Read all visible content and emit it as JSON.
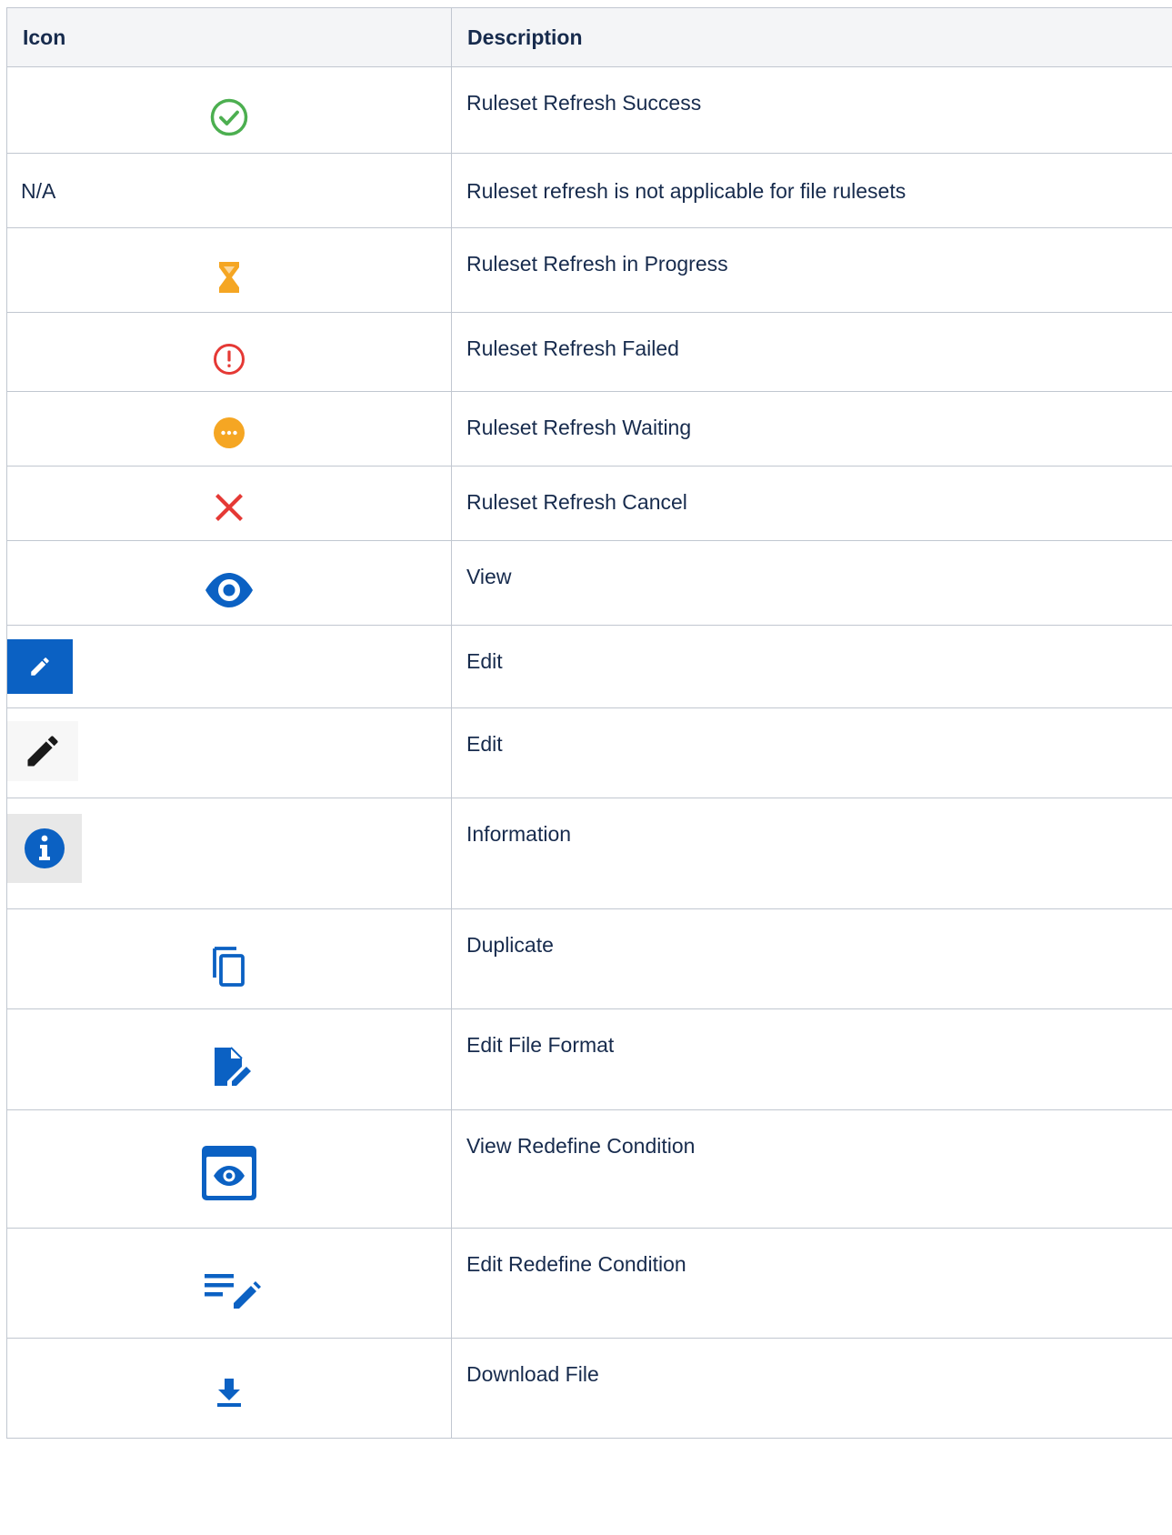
{
  "table": {
    "headers": {
      "icon": "Icon",
      "description": "Description"
    },
    "rows": [
      {
        "icon": "check-circle-icon",
        "icon_text": "",
        "description": "Ruleset Refresh Success"
      },
      {
        "icon": "",
        "icon_text": "N/A",
        "description": "Ruleset refresh is not applicable for file rulesets"
      },
      {
        "icon": "hourglass-icon",
        "icon_text": "",
        "description": "Ruleset Refresh in Progress"
      },
      {
        "icon": "error-circle-icon",
        "icon_text": "",
        "description": "Ruleset Refresh Failed"
      },
      {
        "icon": "waiting-dots-icon",
        "icon_text": "",
        "description": "Ruleset Refresh Waiting"
      },
      {
        "icon": "cancel-x-icon",
        "icon_text": "",
        "description": "Ruleset Refresh Cancel"
      },
      {
        "icon": "eye-icon",
        "icon_text": "",
        "description": "View"
      },
      {
        "icon": "pencil-blue-button-icon",
        "icon_text": "",
        "description": "Edit"
      },
      {
        "icon": "pencil-icon",
        "icon_text": "",
        "description": "Edit"
      },
      {
        "icon": "info-icon",
        "icon_text": "",
        "description": "Information"
      },
      {
        "icon": "duplicate-icon",
        "icon_text": "",
        "description": "Duplicate"
      },
      {
        "icon": "edit-file-icon",
        "icon_text": "",
        "description": "Edit File Format"
      },
      {
        "icon": "view-window-icon",
        "icon_text": "",
        "description": "View Redefine Condition"
      },
      {
        "icon": "edit-lines-icon",
        "icon_text": "",
        "description": "Edit Redefine Condition"
      },
      {
        "icon": "download-icon",
        "icon_text": "",
        "description": "Download File"
      }
    ]
  },
  "colors": {
    "border": "#c1c7d0",
    "header_bg": "#f4f5f7",
    "text": "#172b4d",
    "success_green": "#4caf50",
    "warning_orange": "#f5a623",
    "error_red": "#e53935",
    "primary_blue": "#0b61c3"
  }
}
